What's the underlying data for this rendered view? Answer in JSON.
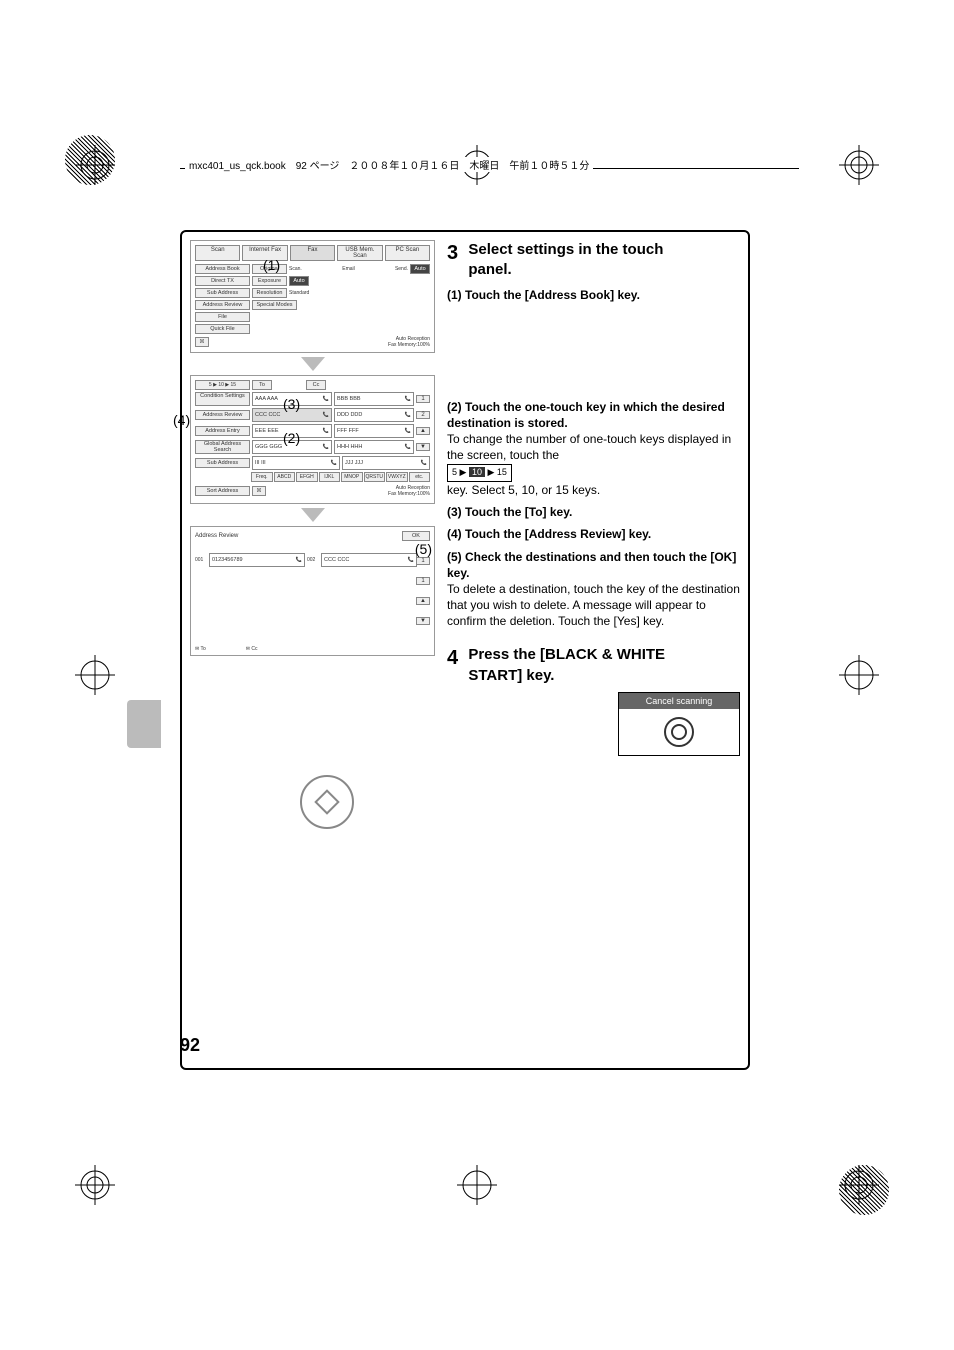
{
  "header": "mxc401_us_qck.book　92 ページ　２００８年１０月１６日　木曜日　午前１０時５１分",
  "page_number": "92",
  "panel1": {
    "tabs": [
      "Scan",
      "Internet Fax",
      "Fax",
      "USB Mem. Scan",
      "PC Scan"
    ],
    "side": [
      "Address Book",
      "Direct TX",
      "Sub Address",
      "Address Review",
      "File",
      "Quick File"
    ],
    "right_labels": {
      "original": "Original",
      "scan": "Scan.",
      "email": "Email",
      "send": "Send.",
      "auto": "Auto",
      "exposure": "Exposure",
      "auto2": "Auto",
      "resolution": "Resolution",
      "standard": "Standard",
      "special": "Special Modes"
    },
    "status": "Auto Reception\nFax Memory:100%"
  },
  "panel2": {
    "tab_nums": "5 ▶ 10 ▶ 15",
    "to": "To",
    "cc": "Cc",
    "side": [
      "Condition Settings",
      "Address Review",
      "Address Entry",
      "Global Address Search",
      "Sub Address"
    ],
    "sort": "Sort Address",
    "entries": [
      [
        "AAA AAA",
        "BBB BBB"
      ],
      [
        "CCC CCC",
        "DDD DDD"
      ],
      [
        "EEE EEE",
        "FFF FFF"
      ],
      [
        "GGG GGG",
        "HHH HHH"
      ],
      [
        "III III",
        "JJJ JJJ"
      ]
    ],
    "freq": "Freq.",
    "letters": [
      "ABCD",
      "EFGH",
      "IJKL",
      "MNOP",
      "QRSTU",
      "VWXYZ",
      "etc."
    ],
    "status": "Auto Reception\nFax Memory:100%"
  },
  "panel3": {
    "title": "Address Review",
    "ok": "OK",
    "entries": [
      {
        "n": "001",
        "v": "0123456789"
      },
      {
        "n": "002",
        "v": "CCC CCC"
      }
    ],
    "to": "To",
    "cc": "Cc"
  },
  "callouts": {
    "c1": "(1)",
    "c2": "(2)",
    "c3": "(3)",
    "c4": "(4)",
    "c5": "(5)"
  },
  "step3": {
    "num": "3",
    "title": "Select settings in the touch panel.",
    "s1": "(1) Touch the [Address Book] key.",
    "s2_head": "(2) Touch the one-touch key in which the desired destination is stored.",
    "s2_body_a": "To change the number of one-touch keys displayed in the screen, touch the",
    "s2_key": "5 ▶ 10 ▶ 15",
    "s2_body_b": "key. Select 5, 10, or 15 keys.",
    "s3": "(3) Touch the [To] key.",
    "s4": "(4) Touch the [Address Review] key.",
    "s5_head": "(5) Check the destinations and then touch the [OK] key.",
    "s5_body": "To delete a destination, touch the key of the destination that you wish to delete. A message will appear to confirm the deletion. Touch the [Yes] key."
  },
  "step4": {
    "num": "4",
    "title": "Press the [BLACK & WHITE START] key.",
    "cancel": "Cancel scanning"
  }
}
